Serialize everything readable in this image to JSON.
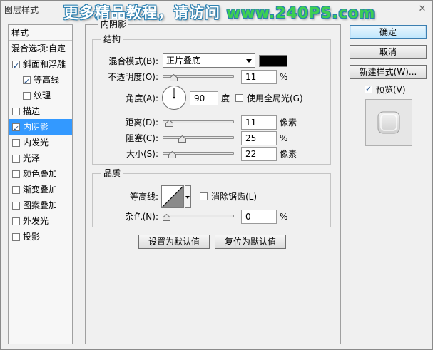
{
  "window": {
    "title": "图层样式",
    "close_glyph": "✕"
  },
  "watermark": {
    "text": "更多精品教程，请访问 ",
    "url": "www.240PS.com"
  },
  "left_list": {
    "header1": "样式",
    "header2": "混合选项:自定",
    "items": [
      {
        "label": "斜面和浮雕",
        "checked": true,
        "indent": false,
        "selected": false
      },
      {
        "label": "等高线",
        "checked": true,
        "indent": true,
        "selected": false
      },
      {
        "label": "纹理",
        "checked": false,
        "indent": true,
        "selected": false
      },
      {
        "label": "描边",
        "checked": false,
        "indent": false,
        "selected": false
      },
      {
        "label": "内阴影",
        "checked": true,
        "indent": false,
        "selected": true
      },
      {
        "label": "内发光",
        "checked": false,
        "indent": false,
        "selected": false
      },
      {
        "label": "光泽",
        "checked": false,
        "indent": false,
        "selected": false
      },
      {
        "label": "颜色叠加",
        "checked": false,
        "indent": false,
        "selected": false
      },
      {
        "label": "渐变叠加",
        "checked": false,
        "indent": false,
        "selected": false
      },
      {
        "label": "图案叠加",
        "checked": false,
        "indent": false,
        "selected": false
      },
      {
        "label": "外发光",
        "checked": false,
        "indent": false,
        "selected": false
      },
      {
        "label": "投影",
        "checked": false,
        "indent": false,
        "selected": false
      }
    ]
  },
  "panel": {
    "title": "内阴影",
    "structure": {
      "title": "结构",
      "blend_mode_label": "混合模式(B):",
      "blend_mode_value": "正片叠底",
      "blend_color": "#000000",
      "opacity_label": "不透明度(O):",
      "opacity_value": "11",
      "opacity_unit": "%",
      "opacity_fraction": 0.11,
      "angle_label": "角度(A):",
      "angle_value": "90",
      "angle_unit": "度",
      "global_light_label": "使用全局光(G)",
      "global_light_checked": false,
      "distance_label": "距离(D):",
      "distance_value": "11",
      "distance_unit": "像素",
      "distance_fraction": 0.04,
      "choke_label": "阻塞(C):",
      "choke_value": "25",
      "choke_unit": "%",
      "choke_fraction": 0.25,
      "size_label": "大小(S):",
      "size_value": "22",
      "size_unit": "像素",
      "size_fraction": 0.09
    },
    "quality": {
      "title": "品质",
      "contour_label": "等高线:",
      "antialias_label": "消除锯齿(L)",
      "antialias_checked": false,
      "noise_label": "杂色(N):",
      "noise_value": "0",
      "noise_unit": "%",
      "noise_fraction": 0.0
    },
    "make_default_label": "设置为默认值",
    "reset_default_label": "复位为默认值"
  },
  "actions": {
    "ok_label": "确定",
    "cancel_label": "取消",
    "new_style_label": "新建样式(W)...",
    "preview_label": "预览(V)",
    "preview_checked": true
  },
  "colors": {
    "selection": "#3399ff",
    "watermark_outline": "#2a7fb0",
    "watermark_url": "#3dcf52"
  }
}
